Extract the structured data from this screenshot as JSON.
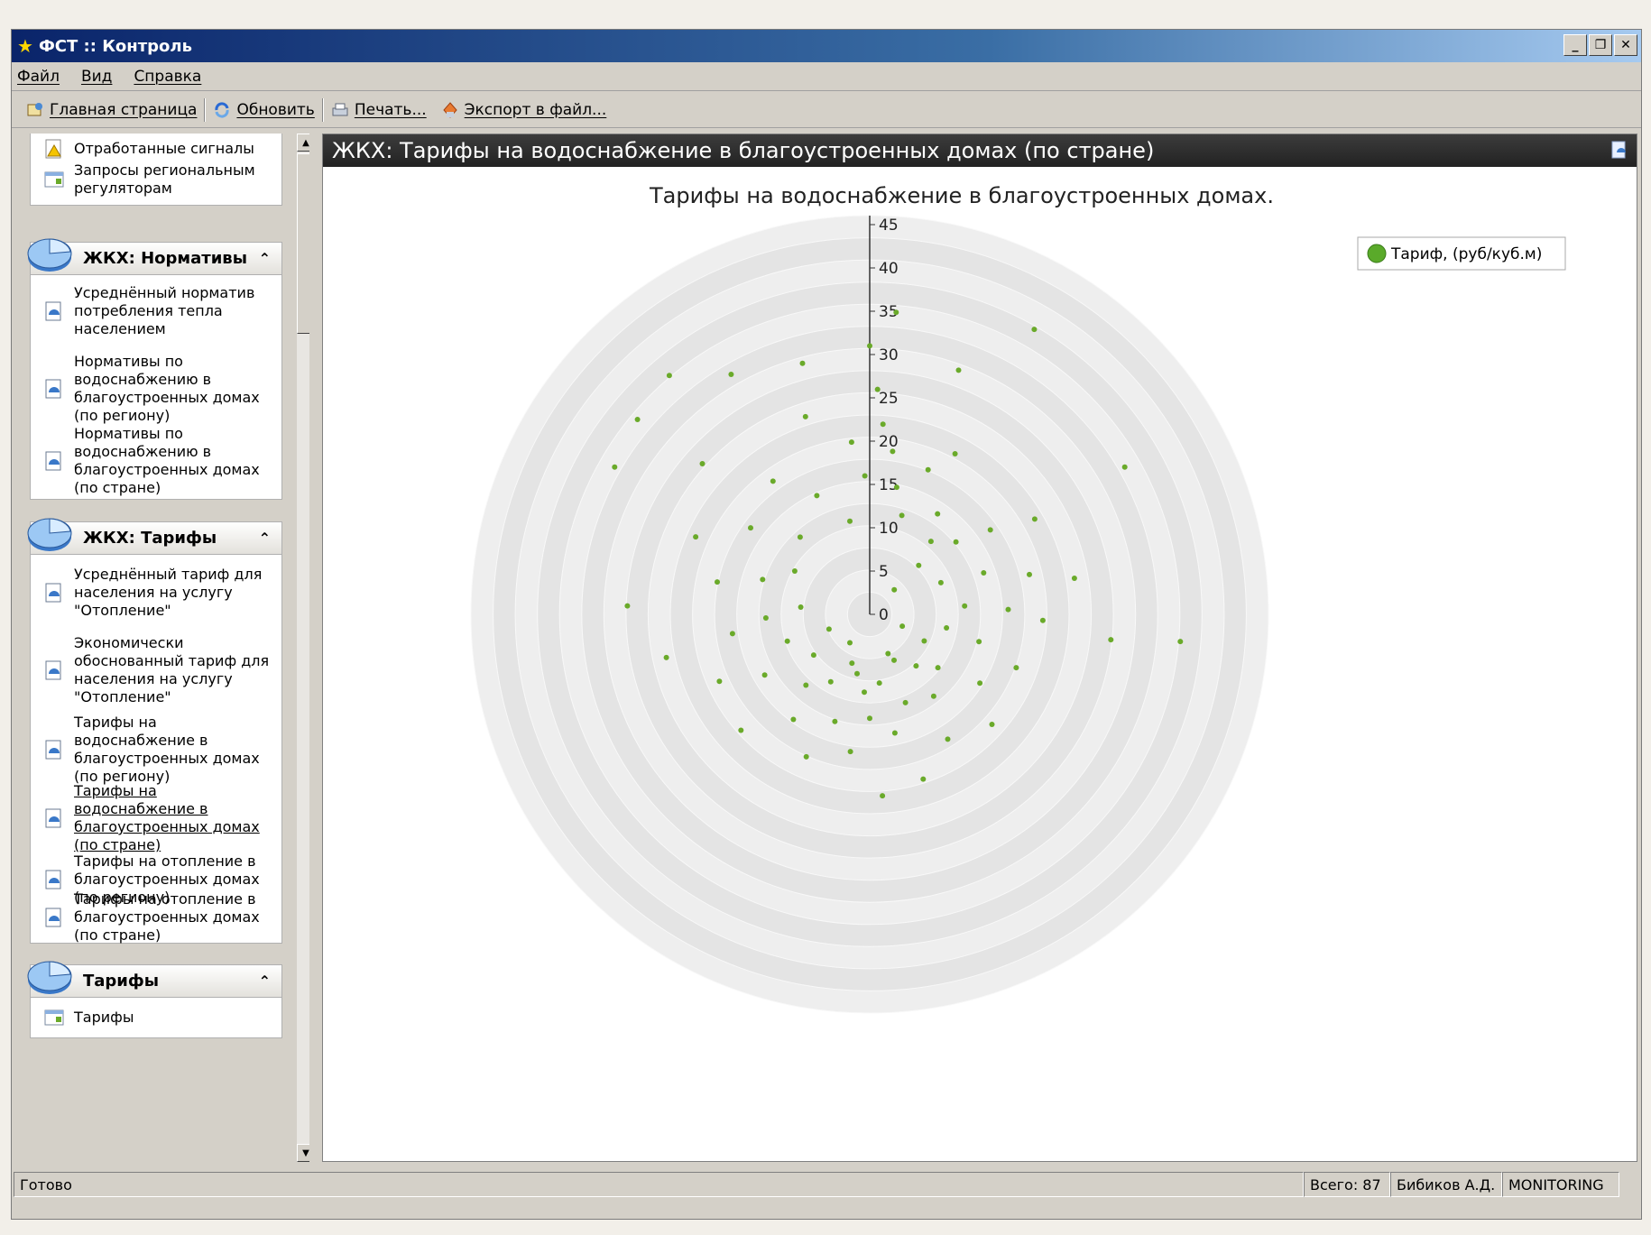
{
  "window": {
    "title": "ФСТ :: Контроль"
  },
  "menu": [
    "Файл",
    "Вид",
    "Справка"
  ],
  "toolbar": {
    "home": "Главная страница",
    "refresh": "Обновить",
    "print": "Печать...",
    "export": "Экспорт в файл..."
  },
  "sidebar": {
    "top_items": [
      "Отработанные сигналы",
      "Запросы региональным регуляторам"
    ],
    "groups": [
      {
        "title": "ЖКХ: Нормативы",
        "items": [
          "Усреднённый норматив потребления тепла населением",
          "Нормативы по водоснабжению в благоустроенных домах (по региону)",
          "Нормативы по водоснабжению в благоустроенных домах (по стране)"
        ]
      },
      {
        "title": "ЖКХ: Тарифы",
        "items": [
          "Усреднённый тариф для населения на услугу \"Отопление\"",
          "Экономически обоснованный тариф для населения на услугу \"Отопление\"",
          "Тарифы на водоснабжение в благоустроенных домах (по региону)",
          "Тарифы на водоснабжение в благоустроенных домах (по стране)",
          "Тарифы на отопление в благоустроенных домах (по региону)",
          "Тарифы на отопление в благоустроенных домах (по стране)"
        ]
      },
      {
        "title": "Тарифы",
        "items": [
          "Тарифы"
        ]
      }
    ]
  },
  "main": {
    "header": "ЖКХ: Тарифы на водоснабжение в благоустроенных домах (по стране)"
  },
  "chart_data": {
    "type": "scatter",
    "subtype": "polar",
    "title": "Тарифы на водоснабжение в благоустроенных домах.",
    "radial_axis": {
      "min": 0,
      "max": 45,
      "ticks": [
        0,
        5,
        10,
        15,
        20,
        25,
        30,
        35,
        40,
        45
      ]
    },
    "series": [
      {
        "name": "Тариф, (руб/куб.м)",
        "color": "#6aaa2a",
        "points": [
          [
            0,
            31
          ],
          [
            2,
            26
          ],
          [
            4,
            22
          ],
          [
            8,
            19
          ],
          [
            12,
            15
          ],
          [
            18,
            12
          ],
          [
            22,
            18
          ],
          [
            28,
            21
          ],
          [
            34,
            14
          ],
          [
            40,
            11
          ],
          [
            45,
            8
          ],
          [
            50,
            13
          ],
          [
            55,
            17
          ],
          [
            60,
            22
          ],
          [
            66,
            9
          ],
          [
            70,
            14
          ],
          [
            76,
            19
          ],
          [
            80,
            24
          ],
          [
            85,
            11
          ],
          [
            88,
            16
          ],
          [
            92,
            20
          ],
          [
            96,
            28
          ],
          [
            100,
            9
          ],
          [
            104,
            13
          ],
          [
            110,
            18
          ],
          [
            116,
            7
          ],
          [
            122,
            15
          ],
          [
            128,
            10
          ],
          [
            132,
            19
          ],
          [
            138,
            8
          ],
          [
            142,
            12
          ],
          [
            148,
            17
          ],
          [
            152,
            6
          ],
          [
            158,
            11
          ],
          [
            162,
            20
          ],
          [
            168,
            14
          ],
          [
            172,
            8
          ],
          [
            176,
            21
          ],
          [
            180,
            12
          ],
          [
            184,
            9
          ],
          [
            188,
            16
          ],
          [
            192,
            7
          ],
          [
            198,
            13
          ],
          [
            204,
            18
          ],
          [
            210,
            9
          ],
          [
            216,
            15
          ],
          [
            222,
            11
          ],
          [
            228,
            20
          ],
          [
            234,
            8
          ],
          [
            240,
            14
          ],
          [
            246,
            19
          ],
          [
            252,
            10
          ],
          [
            258,
            24
          ],
          [
            262,
            16
          ],
          [
            268,
            12
          ],
          [
            272,
            28
          ],
          [
            276,
            8
          ],
          [
            282,
            18
          ],
          [
            288,
            13
          ],
          [
            294,
            22
          ],
          [
            300,
            10
          ],
          [
            306,
            17
          ],
          [
            312,
            26
          ],
          [
            318,
            12
          ],
          [
            324,
            19
          ],
          [
            330,
            32
          ],
          [
            336,
            15
          ],
          [
            342,
            24
          ],
          [
            348,
            11
          ],
          [
            354,
            20
          ],
          [
            358,
            16
          ],
          [
            310,
            35
          ],
          [
            300,
            34
          ],
          [
            320,
            36
          ],
          [
            60,
            34
          ],
          [
            20,
            30
          ],
          [
            30,
            38
          ],
          [
            200,
            6
          ],
          [
            215,
            4
          ],
          [
            155,
            5
          ],
          [
            110,
            4
          ],
          [
            250,
            5
          ],
          [
            45,
            4
          ],
          [
            5,
            35
          ],
          [
            345,
            30
          ],
          [
            95,
            36
          ]
        ]
      }
    ],
    "legend": {
      "position": "top-right",
      "entries": [
        "Тариф, (руб/куб.м)"
      ]
    }
  },
  "status": {
    "left": "Готово",
    "total": "Всего: 87",
    "user": "Бибиков А.Д.",
    "mode": "MONITORING"
  }
}
